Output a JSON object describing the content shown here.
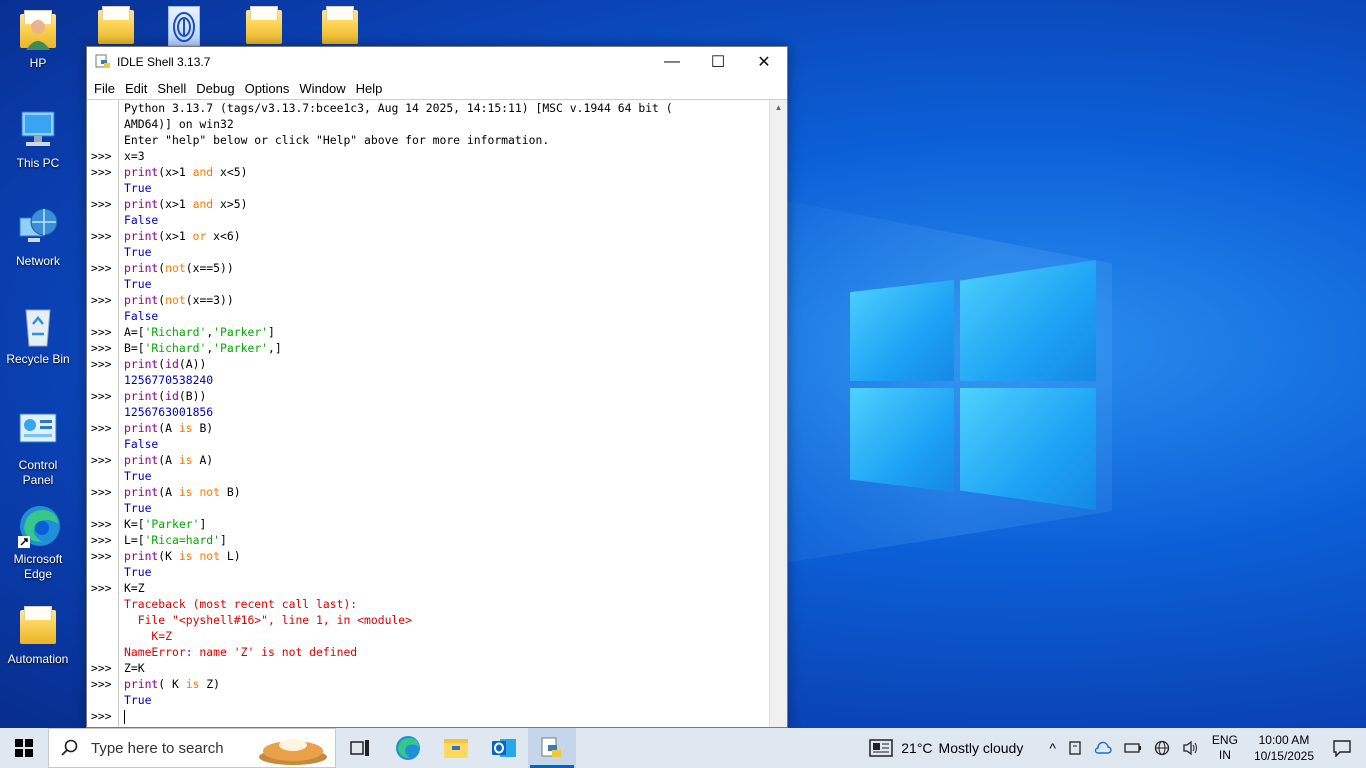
{
  "desktop": {
    "icons": [
      {
        "label": "HP"
      },
      {
        "label": "This PC"
      },
      {
        "label": "Network"
      },
      {
        "label": "Recycle Bin"
      },
      {
        "label": "Control Panel"
      },
      {
        "label": "Microsoft Edge"
      },
      {
        "label": "Automation"
      }
    ]
  },
  "window": {
    "title": "IDLE Shell 3.13.7",
    "controls": {
      "minimize": "—",
      "maximize": "☐",
      "close": "✕"
    },
    "menu": [
      "File",
      "Edit",
      "Shell",
      "Debug",
      "Options",
      "Window",
      "Help"
    ]
  },
  "shell": {
    "prompt": ">>>",
    "lines": [
      {
        "p": "",
        "t": "out0",
        "segs": [
          [
            "Python 3.13.7 (tags/v3.13.7:bcee1c3, Aug 14 2025, 14:15:11) [MSC v.1944 64 bit (",
            "in"
          ]
        ]
      },
      {
        "p": "",
        "segs": [
          [
            "AMD64)] on win32",
            "in"
          ]
        ]
      },
      {
        "p": "",
        "segs": [
          [
            "Enter \"help\" below or click \"Help\" above for more information.",
            "in"
          ]
        ]
      },
      {
        "p": ">>>",
        "segs": [
          [
            "x=3",
            "in"
          ]
        ]
      },
      {
        "p": ">>>",
        "segs": [
          [
            "print",
            "bi"
          ],
          [
            "(x>1 ",
            "in"
          ],
          [
            "and",
            "kw"
          ],
          [
            " x<5)",
            "in"
          ]
        ]
      },
      {
        "p": "",
        "segs": [
          [
            "True",
            "out"
          ]
        ]
      },
      {
        "p": ">>>",
        "segs": [
          [
            "print",
            "bi"
          ],
          [
            "(x>1 ",
            "in"
          ],
          [
            "and",
            "kw"
          ],
          [
            " x>5)",
            "in"
          ]
        ]
      },
      {
        "p": "",
        "segs": [
          [
            "False",
            "out"
          ]
        ]
      },
      {
        "p": ">>>",
        "segs": [
          [
            "print",
            "bi"
          ],
          [
            "(x>1 ",
            "in"
          ],
          [
            "or",
            "kw"
          ],
          [
            " x<6)",
            "in"
          ]
        ]
      },
      {
        "p": "",
        "segs": [
          [
            "True",
            "out"
          ]
        ]
      },
      {
        "p": ">>>",
        "segs": [
          [
            "print",
            "bi"
          ],
          [
            "(",
            "in"
          ],
          [
            "not",
            "kw"
          ],
          [
            "(x==5))",
            "in"
          ]
        ]
      },
      {
        "p": "",
        "segs": [
          [
            "True",
            "out"
          ]
        ]
      },
      {
        "p": ">>>",
        "segs": [
          [
            "print",
            "bi"
          ],
          [
            "(",
            "in"
          ],
          [
            "not",
            "kw"
          ],
          [
            "(x==3))",
            "in"
          ]
        ]
      },
      {
        "p": "",
        "segs": [
          [
            "False",
            "out"
          ]
        ]
      },
      {
        "p": ">>>",
        "segs": [
          [
            "A=[",
            "in"
          ],
          [
            "'Richard'",
            "str"
          ],
          [
            ",",
            "in"
          ],
          [
            "'Parker'",
            "str"
          ],
          [
            "]",
            "in"
          ]
        ]
      },
      {
        "p": ">>>",
        "segs": [
          [
            "B=[",
            "in"
          ],
          [
            "'Richard'",
            "str"
          ],
          [
            ",",
            "in"
          ],
          [
            "'Parker'",
            "str"
          ],
          [
            ",]",
            "in"
          ]
        ]
      },
      {
        "p": ">>>",
        "segs": [
          [
            "print",
            "bi"
          ],
          [
            "(",
            "in"
          ],
          [
            "id",
            "bi"
          ],
          [
            "(A))",
            "in"
          ]
        ]
      },
      {
        "p": "",
        "segs": [
          [
            "1256770538240",
            "out"
          ]
        ]
      },
      {
        "p": ">>>",
        "segs": [
          [
            "print",
            "bi"
          ],
          [
            "(",
            "in"
          ],
          [
            "id",
            "bi"
          ],
          [
            "(B))",
            "in"
          ]
        ]
      },
      {
        "p": "",
        "segs": [
          [
            "1256763001856",
            "out"
          ]
        ]
      },
      {
        "p": ">>>",
        "segs": [
          [
            "print",
            "bi"
          ],
          [
            "(A ",
            "in"
          ],
          [
            "is",
            "kw"
          ],
          [
            " B)",
            "in"
          ]
        ]
      },
      {
        "p": "",
        "segs": [
          [
            "False",
            "out"
          ]
        ]
      },
      {
        "p": ">>>",
        "segs": [
          [
            "print",
            "bi"
          ],
          [
            "(A ",
            "in"
          ],
          [
            "is",
            "kw"
          ],
          [
            " A)",
            "in"
          ]
        ]
      },
      {
        "p": "",
        "segs": [
          [
            "True",
            "out"
          ]
        ]
      },
      {
        "p": ">>>",
        "segs": [
          [
            "print",
            "bi"
          ],
          [
            "(A ",
            "in"
          ],
          [
            "is not",
            "kw"
          ],
          [
            " B)",
            "in"
          ]
        ]
      },
      {
        "p": "",
        "segs": [
          [
            "True",
            "out"
          ]
        ]
      },
      {
        "p": ">>>",
        "segs": [
          [
            "K=[",
            "in"
          ],
          [
            "'Parker'",
            "str"
          ],
          [
            "]",
            "in"
          ]
        ]
      },
      {
        "p": ">>>",
        "segs": [
          [
            "L=[",
            "in"
          ],
          [
            "'Rica=hard'",
            "str"
          ],
          [
            "]",
            "in"
          ]
        ]
      },
      {
        "p": ">>>",
        "segs": [
          [
            "print",
            "bi"
          ],
          [
            "(K ",
            "in"
          ],
          [
            "is not",
            "kw"
          ],
          [
            " L)",
            "in"
          ]
        ]
      },
      {
        "p": "",
        "segs": [
          [
            "True",
            "out"
          ]
        ]
      },
      {
        "p": ">>>",
        "segs": [
          [
            "K=Z",
            "in"
          ]
        ]
      },
      {
        "p": "",
        "segs": [
          [
            "Traceback (most recent call last):",
            "err"
          ]
        ]
      },
      {
        "p": "",
        "segs": [
          [
            "  File \"<pyshell#16>\", line 1, in <module>",
            "err"
          ]
        ]
      },
      {
        "p": "",
        "segs": [
          [
            "    K=Z",
            "err"
          ]
        ]
      },
      {
        "p": "",
        "segs": [
          [
            "NameError: name 'Z' is not defined",
            "err"
          ]
        ]
      },
      {
        "p": ">>>",
        "segs": [
          [
            "Z=K",
            "in"
          ]
        ]
      },
      {
        "p": ">>>",
        "segs": [
          [
            "print",
            "bi"
          ],
          [
            "( K ",
            "in"
          ],
          [
            "is",
            "kw"
          ],
          [
            " Z)",
            "in"
          ]
        ]
      },
      {
        "p": "",
        "segs": [
          [
            "True",
            "out"
          ]
        ]
      },
      {
        "p": ">>>",
        "segs": [],
        "cursor": true
      }
    ]
  },
  "taskbar": {
    "search_placeholder": "Type here to search",
    "weather": {
      "temp": "21°C",
      "desc": "Mostly cloudy"
    },
    "lang": {
      "line1": "ENG",
      "line2": "IN"
    },
    "clock": {
      "time": "10:00 AM",
      "date": "10/15/2025"
    }
  }
}
